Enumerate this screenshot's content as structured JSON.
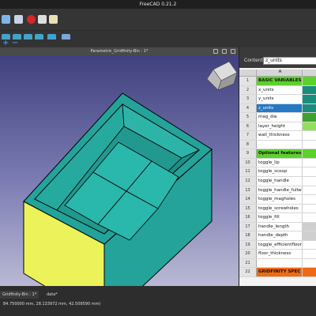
{
  "window": {
    "title": "FreeCAD 0.21.2"
  },
  "viewport": {
    "title": "Parametric_Gridfinity-Bin : 1*"
  },
  "spreadsheet": {
    "content_label": "Content:",
    "content_value": "z_units",
    "column_header": "A",
    "rows": [
      {
        "n": "1",
        "a": "BASIC VARIABLES - Create",
        "style": "green"
      },
      {
        "n": "2",
        "a": "x_units",
        "style": "plain"
      },
      {
        "n": "3",
        "a": "y_units",
        "style": "plain"
      },
      {
        "n": "4",
        "a": "z_units",
        "style": "selected"
      },
      {
        "n": "5",
        "a": "mag_dia",
        "style": "plain"
      },
      {
        "n": "6",
        "a": "layer_height",
        "style": "plain"
      },
      {
        "n": "7",
        "a": "wall_thickness",
        "style": "plain"
      },
      {
        "n": "8",
        "a": "",
        "style": "plain"
      },
      {
        "n": "9",
        "a": "Optional features: Set to",
        "style": "green"
      },
      {
        "n": "10",
        "a": "toggle_lip",
        "style": "plain"
      },
      {
        "n": "11",
        "a": "toggle_scoop",
        "style": "plain"
      },
      {
        "n": "12",
        "a": "toggle_handle",
        "style": "plain"
      },
      {
        "n": "13",
        "a": "toggle_handle_fullwidth",
        "style": "plain"
      },
      {
        "n": "14",
        "a": "toggle_magholes",
        "style": "plain"
      },
      {
        "n": "15",
        "a": "toggle_screwholes",
        "style": "plain"
      },
      {
        "n": "16",
        "a": "toggle_fill",
        "style": "plain"
      },
      {
        "n": "17",
        "a": "handle_length",
        "style": "plain"
      },
      {
        "n": "18",
        "a": "handle_depth",
        "style": "plain"
      },
      {
        "n": "19",
        "a": "toggle_efficientfloor",
        "style": "plain"
      },
      {
        "n": "20",
        "a": "floor_thickness",
        "style": "plain"
      },
      {
        "n": "21",
        "a": "",
        "style": "plain"
      },
      {
        "n": "22",
        "a": "GRIDFINITY SPEC BASE VA",
        "style": "orange"
      }
    ]
  },
  "tabs": {
    "doc": "Gridfinity-Bin : 1*",
    "data": "data*"
  },
  "status": {
    "coords": "84.750000 mm, 28.133972 mm, 42.509590 mm)"
  },
  "colors": {
    "teal": "#23a39a",
    "yellow": "#ecf25a",
    "green": "#5cd12a",
    "orange": "#ef6a13",
    "selected": "#2479c5"
  }
}
